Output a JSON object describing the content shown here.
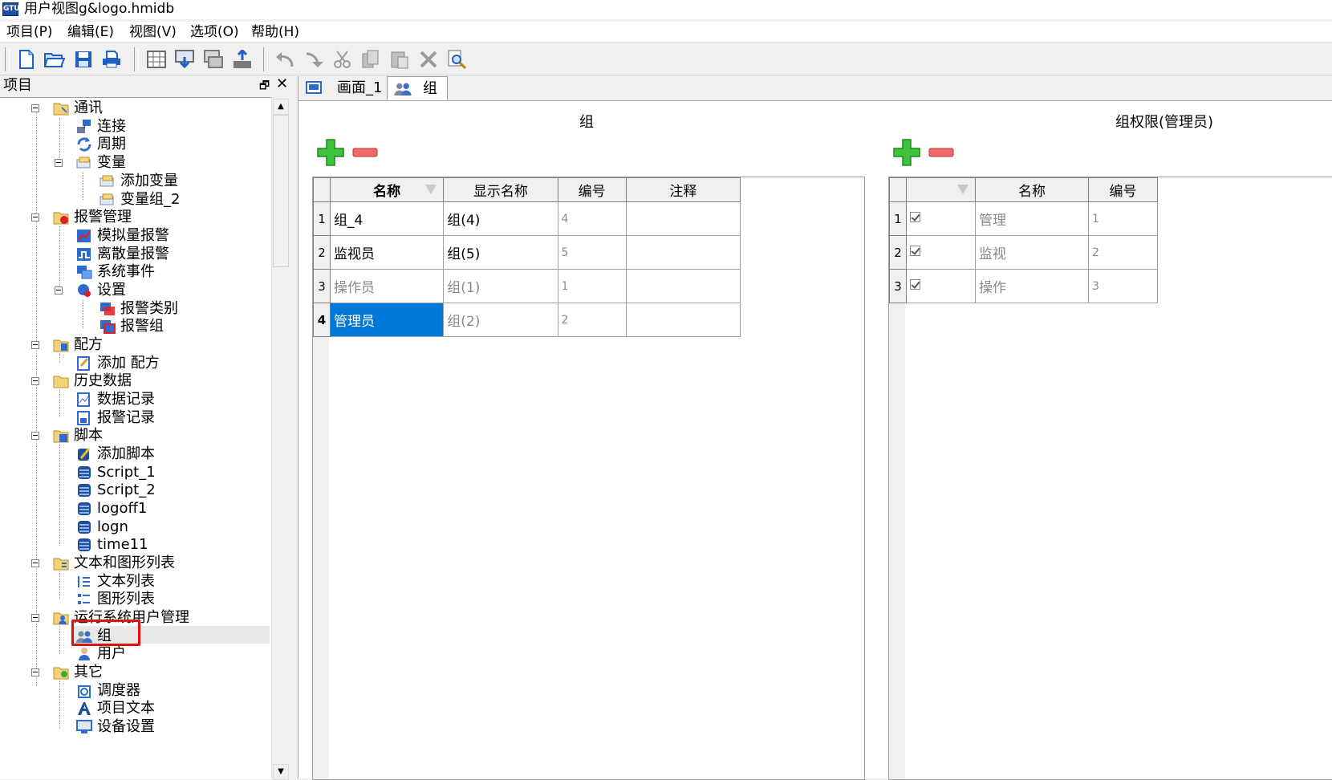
{
  "window": {
    "title": "用户视图g&logo.hmidb",
    "icon": "app-icon",
    "icon_text": "GTU"
  },
  "menu": [
    {
      "label": "项目(P)"
    },
    {
      "label": "编辑(E)"
    },
    {
      "label": "视图(V)"
    },
    {
      "label": "选项(O)"
    },
    {
      "label": "帮助(H)"
    }
  ],
  "toolbar": {
    "buttons": [
      "new-file-icon",
      "open-folder-icon",
      "save-icon",
      "print-icon",
      "grid-icon",
      "download-screen-icon",
      "screen-icon",
      "upload-icon",
      "undo-icon",
      "redo-icon",
      "cut-icon",
      "copy-icon",
      "paste-icon",
      "delete-icon",
      "find-icon"
    ]
  },
  "project_panel": {
    "title": "项目",
    "tree": [
      {
        "label": "通讯",
        "icon": "folder-icon"
      },
      {
        "label": "连接",
        "icon": "connection-icon"
      },
      {
        "label": "周期",
        "icon": "cycle-icon"
      },
      {
        "label": "变量",
        "icon": "variable-icon"
      },
      {
        "label": "添加变量",
        "icon": "variable-icon"
      },
      {
        "label": "变量组_2",
        "icon": "variable-icon"
      },
      {
        "label": "报警管理",
        "icon": "alarm-folder-icon"
      },
      {
        "label": "模拟量报警",
        "icon": "analog-alarm-icon"
      },
      {
        "label": "离散量报警",
        "icon": "discrete-alarm-icon"
      },
      {
        "label": "系统事件",
        "icon": "system-event-icon"
      },
      {
        "label": "设置",
        "icon": "settings-icon"
      },
      {
        "label": "报警类别",
        "icon": "alarm-class-icon"
      },
      {
        "label": "报警组",
        "icon": "alarm-group-icon"
      },
      {
        "label": "配方",
        "icon": "recipe-folder-icon"
      },
      {
        "label": "添加 配方",
        "icon": "recipe-icon"
      },
      {
        "label": "历史数据",
        "icon": "history-folder-icon"
      },
      {
        "label": "数据记录",
        "icon": "data-log-icon"
      },
      {
        "label": "报警记录",
        "icon": "alarm-log-icon"
      },
      {
        "label": "脚本",
        "icon": "script-folder-icon"
      },
      {
        "label": "添加脚本",
        "icon": "add-script-icon"
      },
      {
        "label": "Script_1",
        "icon": "script-icon"
      },
      {
        "label": "Script_2",
        "icon": "script-icon"
      },
      {
        "label": "logoff1",
        "icon": "script-icon"
      },
      {
        "label": "logn",
        "icon": "script-icon"
      },
      {
        "label": "time11",
        "icon": "script-icon"
      },
      {
        "label": "文本和图形列表",
        "icon": "list-folder-icon"
      },
      {
        "label": "文本列表",
        "icon": "text-list-icon"
      },
      {
        "label": "图形列表",
        "icon": "graphic-list-icon"
      },
      {
        "label": "运行系统用户管理",
        "icon": "user-admin-folder-icon"
      },
      {
        "label": "组",
        "icon": "group-icon"
      },
      {
        "label": "用户",
        "icon": "user-icon"
      },
      {
        "label": "其它",
        "icon": "other-folder-icon"
      },
      {
        "label": "调度器",
        "icon": "scheduler-icon"
      },
      {
        "label": "项目文本",
        "icon": "project-text-icon"
      },
      {
        "label": "设备设置",
        "icon": "device-settings-icon"
      }
    ]
  },
  "tabs": [
    {
      "label": "画面_1",
      "icon": "screen-tab-icon"
    },
    {
      "label": "组",
      "icon": "group-tab-icon"
    }
  ],
  "groups": {
    "title": "组",
    "columns": [
      "名称",
      "显示名称",
      "编号",
      "注释"
    ],
    "rows": [
      {
        "n": "1",
        "name": "组_4",
        "display": "组(4)",
        "id": "4",
        "note": ""
      },
      {
        "n": "2",
        "name": "监视员",
        "display": "组(5)",
        "id": "5",
        "note": ""
      },
      {
        "n": "3",
        "name": "操作员",
        "display": "组(1)",
        "id": "1",
        "note": ""
      },
      {
        "n": "4",
        "name": "管理员",
        "display": "组(2)",
        "id": "2",
        "note": ""
      }
    ]
  },
  "permissions": {
    "title": "组权限(管理员)",
    "columns": [
      "",
      "名称",
      "编号"
    ],
    "rows": [
      {
        "n": "1",
        "checked": true,
        "name": "管理",
        "id": "1"
      },
      {
        "n": "2",
        "checked": true,
        "name": "监视",
        "id": "2"
      },
      {
        "n": "3",
        "checked": true,
        "name": "操作",
        "id": "3"
      }
    ]
  }
}
